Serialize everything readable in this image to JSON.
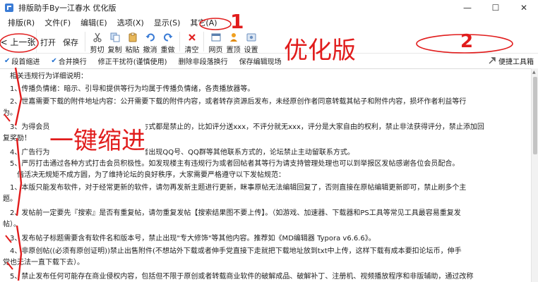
{
  "window": {
    "title": "排版助手By一江春水 优化版",
    "controls": {
      "minimize": "—",
      "maximize": "☐",
      "close": "✕"
    }
  },
  "menu": [
    {
      "label": "排版(R)"
    },
    {
      "label": "文件(F)"
    },
    {
      "label": "编辑(E)"
    },
    {
      "label": "选项(X)"
    },
    {
      "label": "显示(S)"
    },
    {
      "label": "其它(A)"
    }
  ],
  "toolbar": {
    "back_label": "< 上一张",
    "tools": [
      {
        "label": "打开",
        "icon": "open-icon"
      },
      {
        "label": "保存",
        "icon": "save-icon"
      },
      {
        "label": "剪切",
        "icon": "cut-icon"
      },
      {
        "label": "复制",
        "icon": "copy-icon"
      },
      {
        "label": "粘贴",
        "icon": "paste-icon"
      },
      {
        "label": "撤消",
        "icon": "undo-icon"
      },
      {
        "label": "重做",
        "icon": "redo-icon"
      },
      {
        "label": "清空",
        "icon": "clear-icon"
      },
      {
        "label": "网页",
        "icon": "webpage-icon"
      },
      {
        "label": "置顶",
        "icon": "pin-top-icon"
      },
      {
        "label": "设置",
        "icon": "settings-icon"
      }
    ]
  },
  "subbar": {
    "items": [
      {
        "label": "段首缩进",
        "checked": true
      },
      {
        "label": "合并换行",
        "checked": true
      },
      {
        "label": "修正干扰符(谨慎使用)",
        "checked": false
      },
      {
        "label": "删除非段落换行",
        "checked": false
      },
      {
        "label": "保存编辑现场",
        "checked": false
      }
    ],
    "right_label": "便捷工具箱",
    "right_icon": "toolbox-icon"
  },
  "editor": {
    "lines": [
      "　相关违规行为详细说明：",
      "　1、传播负情绪：暗示、引导和提供等行为均属于传播负情绪，各责播放器等。",
      "　2、世嘉需要下载的附件地址内容：公开需要下载的附件内容，或者转存资源后发布，未经原创作者同意转载其帖子和附件内容，损坏作者利益等行",
      "为。",
      "　3、为得会员评论，不论其评论（分享）的方式都是禁止的，比如评分送xxx，不评分就无xxx，评分是大家自由的权利，禁止非法获得评分，禁止添加回",
      "复奖励！",
      "　4、广告行为：软件或压缩包内植入广告或者出现QQ号、QQ群等其他联系方式的，论坛禁止主动留联系方式。",
      "　5、严厉打击通过各种方式打击会员积极性。如发现楼主有违规行为或者回帖者其等行为请支持管理处理也可以到举报区发帖感谢各位会员配合。",
      "　　偕活决无规矩不成方圆，为了维持论坛的良好秩序，大家需要严格遵守以下发帖规范：",
      "　1、本版只能发布软件，对于经常更新的软件，请勿再发新主题进行更新，眯事原帖无法编辑回复了，否则直接在原帖编辑更新即可，禁止刷多个主",
      "题。",
      "　2、发帖前一定要先『搜索』是否有重复帖，请勿重复发帖【搜索结果图不要上传】。（如游戏、加速器、下载器和PS工具等常见工具最容易重复发",
      "帖）。",
      "　3、发布帖子标题需要含有软件名和版本号，禁止出现\"专大修饰\"等其他内容。推荐如《MD编辑器 Typora v6.6.6》。",
      "　4、非原创帖((必须有原创证明))禁止出售附件(不想站外下载或者伸手党直接下走就把下载地址放到txt中上传，这样下载有成本要扣论坛币，伸手",
      "党也无法一直下载下去）。",
      "　5、禁止发布任何可能存在商业侵权内容，包括但不限于原创或者转载商业软件的破解成品、破解补丁、注册机、视频播放程序和非版辅助，通过改称"
    ]
  },
  "annotations": {
    "callout_1": "1",
    "callout_2": "2",
    "optimized_label": "优化版",
    "indent_label": "一键缩进"
  },
  "colors": {
    "annotation_red": "#e11c1c",
    "accent_blue": "#1f6fd0"
  }
}
